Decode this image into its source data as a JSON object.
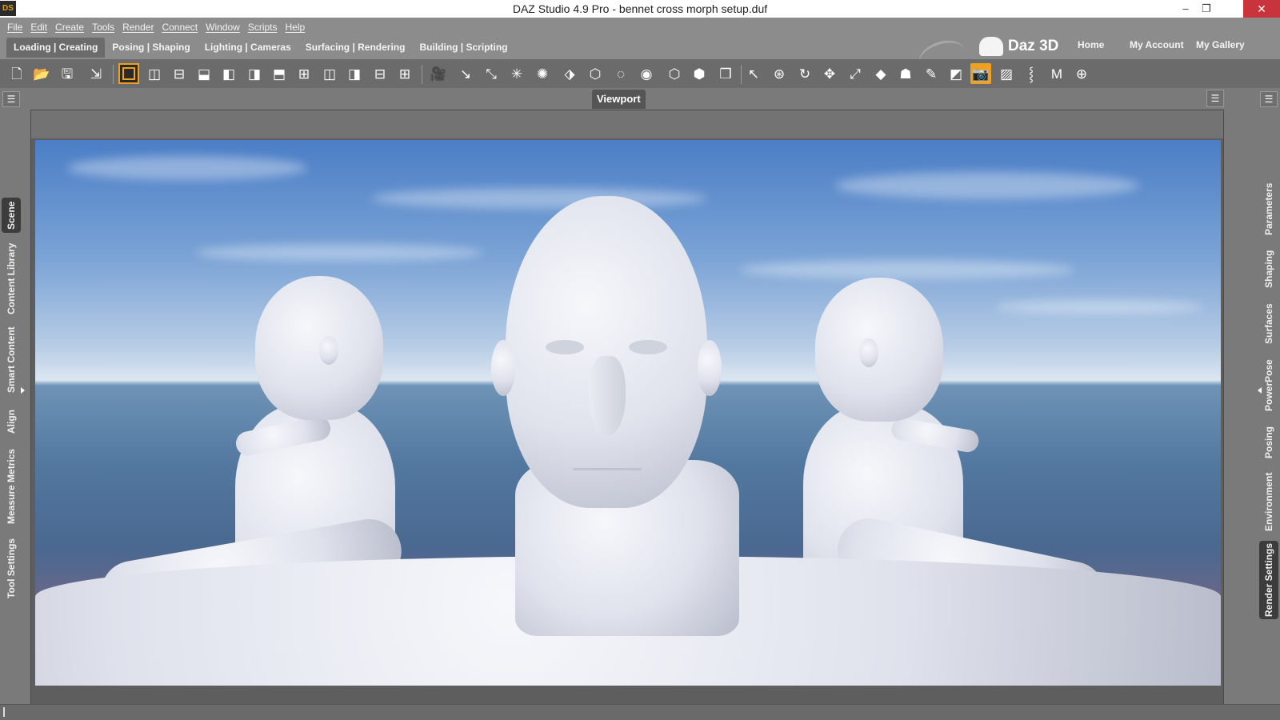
{
  "window": {
    "app_icon": "DS",
    "title": "DAZ Studio 4.9 Pro - bennet cross morph setup.duf",
    "minimize_glyph": "–",
    "restore_glyph": "❐",
    "close_glyph": "✕"
  },
  "menu": [
    "File",
    "Edit",
    "Create",
    "Tools",
    "Render",
    "Connect",
    "Window",
    "Scripts",
    "Help"
  ],
  "tabs": [
    {
      "label": "Loading | Creating",
      "active": true
    },
    {
      "label": "Posing | Shaping",
      "active": false
    },
    {
      "label": "Lighting | Cameras",
      "active": false
    },
    {
      "label": "Surfacing | Rendering",
      "active": false
    },
    {
      "label": "Building | Scripting",
      "active": false
    }
  ],
  "brand": {
    "name": "Daz 3D"
  },
  "top_links": [
    "Home",
    "My Account",
    "My Gallery"
  ],
  "left_panel": {
    "menu_glyph": "☰",
    "tabs": [
      {
        "label": "Scene",
        "active": true
      },
      {
        "label": "Content Library",
        "active": false
      },
      {
        "label": "Smart Content",
        "active": false
      },
      {
        "label": "Align",
        "active": false
      },
      {
        "label": "Measure Metrics",
        "active": false
      },
      {
        "label": "Tool Settings",
        "active": false
      }
    ]
  },
  "right_panel": {
    "menu_glyph": "☰",
    "tabs": [
      {
        "label": "Parameters",
        "active": false
      },
      {
        "label": "Shaping",
        "active": false
      },
      {
        "label": "Surfaces",
        "active": false
      },
      {
        "label": "PowerPose",
        "active": false
      },
      {
        "label": "Posing",
        "active": false
      },
      {
        "label": "Environment",
        "active": false
      },
      {
        "label": "Render Settings",
        "active": true
      }
    ]
  },
  "viewport": {
    "title": "Viewport",
    "menu_glyph": "☰"
  },
  "colors": {
    "accent": "#f0a020",
    "chrome": "#8c8c8c",
    "toolbar": "#6b6b6b",
    "close": "#c8333c"
  }
}
